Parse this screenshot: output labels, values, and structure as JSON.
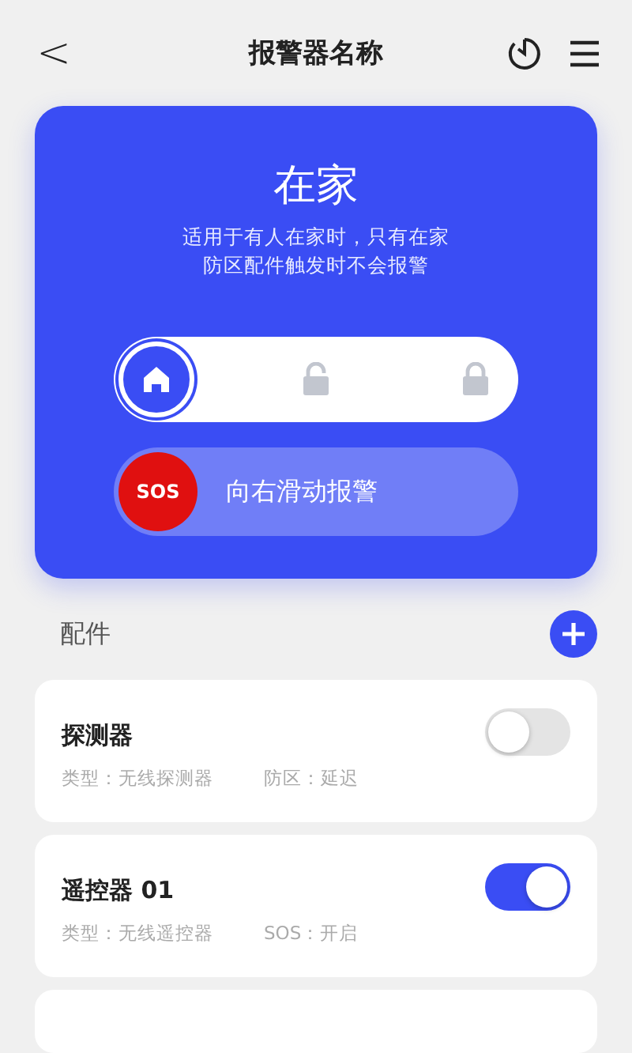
{
  "header": {
    "back": "<",
    "title": "报警器名称"
  },
  "mode_panel": {
    "title": "在家",
    "description": [
      "适用于有人在家时，只有在家",
      "防区配件触发时不会报警"
    ],
    "modes": [
      {
        "kind": "home",
        "selected": true
      },
      {
        "kind": "unlocked",
        "selected": false
      },
      {
        "kind": "locked",
        "selected": false
      }
    ],
    "sos_slider": {
      "button": "SOS",
      "level": 0,
      "hint": "向右滑动报警"
    }
  },
  "accessories": {
    "title": "配件",
    "items": [
      {
        "name": "探测器",
        "type": "类型：无线探测器",
        "detail": "防区：延迟",
        "on": false
      },
      {
        "name": "遥控器 01",
        "type": "类型：无线遥控器",
        "detail": "SOS：开启",
        "on": true
      },
      {
        "kind": "partial"
      }
    ]
  }
}
